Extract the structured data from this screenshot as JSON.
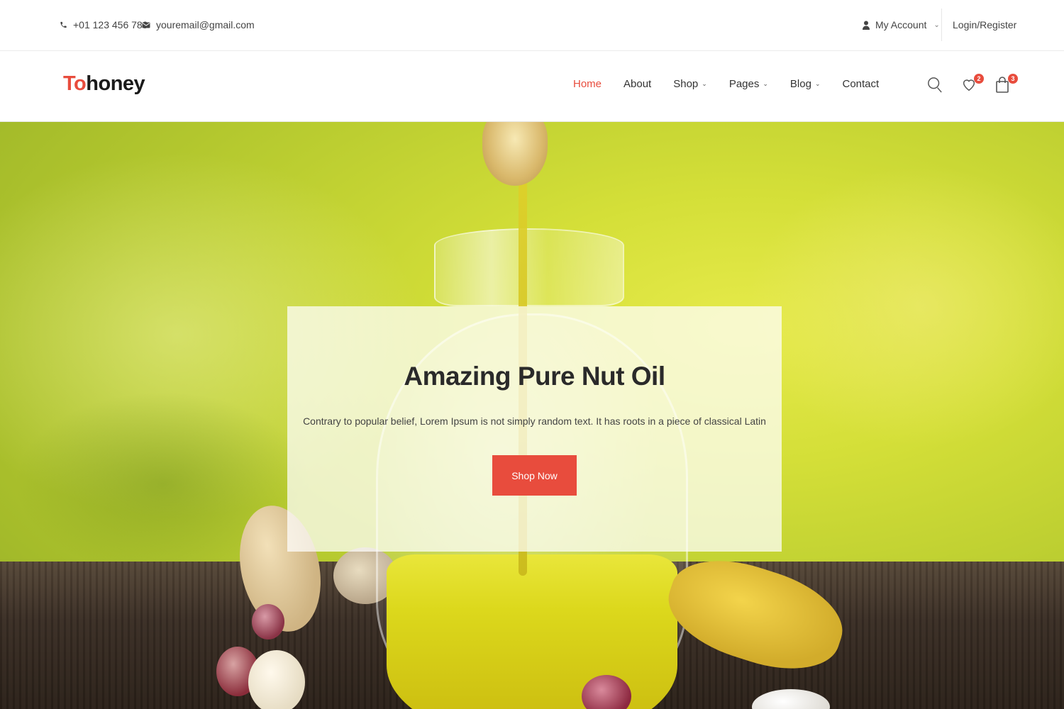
{
  "topbar": {
    "phone": "+01 123 456 789",
    "email": "youremail@gmail.com",
    "account_label": "My Account",
    "login_label": "Login/Register"
  },
  "header": {
    "logo_accent": "To",
    "logo_rest": "honey",
    "nav": [
      {
        "label": "Home",
        "active": true
      },
      {
        "label": "About"
      },
      {
        "label": "Shop",
        "dropdown": true
      },
      {
        "label": "Pages",
        "dropdown": true
      },
      {
        "label": "Blog",
        "dropdown": true
      },
      {
        "label": "Contact"
      }
    ],
    "wishlist_count": "2",
    "cart_count": "3"
  },
  "hero": {
    "title": "Amazing Pure Nut Oil",
    "description": "Contrary to popular belief, Lorem Ipsum is not simply random text. It has roots in a piece of classical Latin",
    "button_label": "Shop Now"
  },
  "colors": {
    "accent": "#e84c3d"
  },
  "icons": [
    "phone-icon",
    "mail-icon",
    "user-icon",
    "search-icon",
    "heart-icon",
    "cart-icon",
    "chevron-down-icon"
  ]
}
